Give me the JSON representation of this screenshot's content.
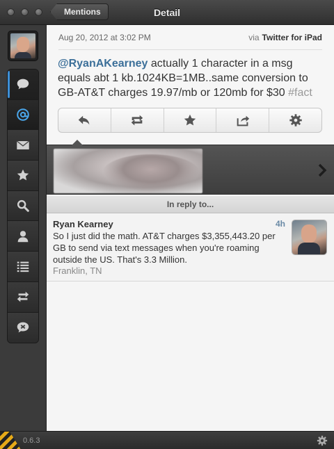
{
  "window": {
    "title": "Detail",
    "back_label": "Mentions"
  },
  "sidebar": {
    "items": [
      {
        "name": "timeline",
        "icon": "speech-bubble-icon"
      },
      {
        "name": "mentions",
        "icon": "at-icon"
      },
      {
        "name": "messages",
        "icon": "envelope-icon"
      },
      {
        "name": "favorites",
        "icon": "star-icon"
      },
      {
        "name": "search",
        "icon": "search-icon"
      },
      {
        "name": "profile",
        "icon": "user-icon"
      },
      {
        "name": "lists",
        "icon": "list-icon"
      },
      {
        "name": "retweets",
        "icon": "retweet-icon"
      },
      {
        "name": "muted",
        "icon": "mute-bubble-icon"
      }
    ],
    "active": "mentions"
  },
  "tweet": {
    "date": "Aug 20, 2012 at 3:02 PM",
    "via_prefix": "via",
    "source": "Twitter for iPad",
    "mention": "@RyanAKearney",
    "text": " actually 1 character in a msg equals abt 1 kb.1024KB=1MB..same conversion to GB-AT&T charges 19.97/mb or 120mb for $30 ",
    "hashtag": "#fact",
    "actions": [
      "reply-icon",
      "retweet-icon",
      "star-icon",
      "share-icon",
      "gear-icon"
    ]
  },
  "in_reply_to": {
    "header": "In reply to...",
    "name": "Ryan Kearney",
    "time": "4h",
    "text": "So I just did the math. AT&T charges $3,355,443.20 per GB to send via text messages when you're roaming outside the US. That's 3.3 Million.",
    "location": "Franklin, TN"
  },
  "footer": {
    "version": "0.6.3"
  },
  "colors": {
    "accent": "#3d8fd6",
    "mention": "#3b6f99",
    "hashtag": "#999999",
    "sidebar": "#3b3b3b"
  }
}
